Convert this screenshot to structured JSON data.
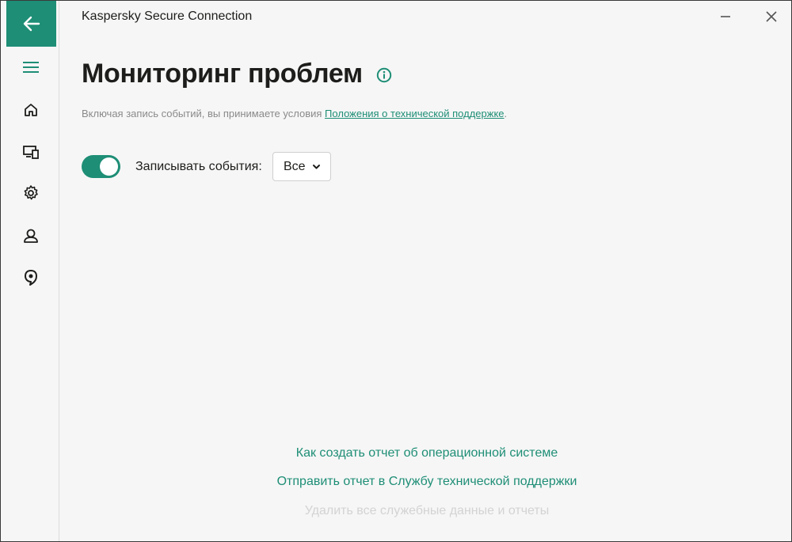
{
  "app": {
    "title": "Kaspersky Secure Connection"
  },
  "window_controls": {
    "minimize": "–",
    "close": "✕"
  },
  "sidebar": {
    "items": [
      {
        "name": "back",
        "icon": "arrow-left-icon"
      },
      {
        "name": "menu",
        "icon": "hamburger-icon"
      },
      {
        "name": "home",
        "icon": "home-icon"
      },
      {
        "name": "devices",
        "icon": "devices-icon"
      },
      {
        "name": "settings",
        "icon": "gear-icon"
      },
      {
        "name": "account",
        "icon": "user-icon"
      },
      {
        "name": "support",
        "icon": "support-icon"
      }
    ]
  },
  "page": {
    "title": "Мониторинг проблем",
    "disclaimer_text": "Включая запись событий, вы принимаете условия ",
    "disclaimer_link": "Положения о технической поддержке",
    "disclaimer_end": ".",
    "record_label": "Записывать события:",
    "record_enabled": true,
    "record_select_value": "Все"
  },
  "links": {
    "create_report": "Как создать отчет об операционной системе",
    "send_report": "Отправить отчет в Службу технической поддержки",
    "delete_data": "Удалить все служебные данные и отчеты"
  },
  "colors": {
    "accent": "#1e8e76",
    "background": "#f6f6f6",
    "muted_text": "#8a8a8a",
    "disabled_text": "#d3d3d3"
  }
}
